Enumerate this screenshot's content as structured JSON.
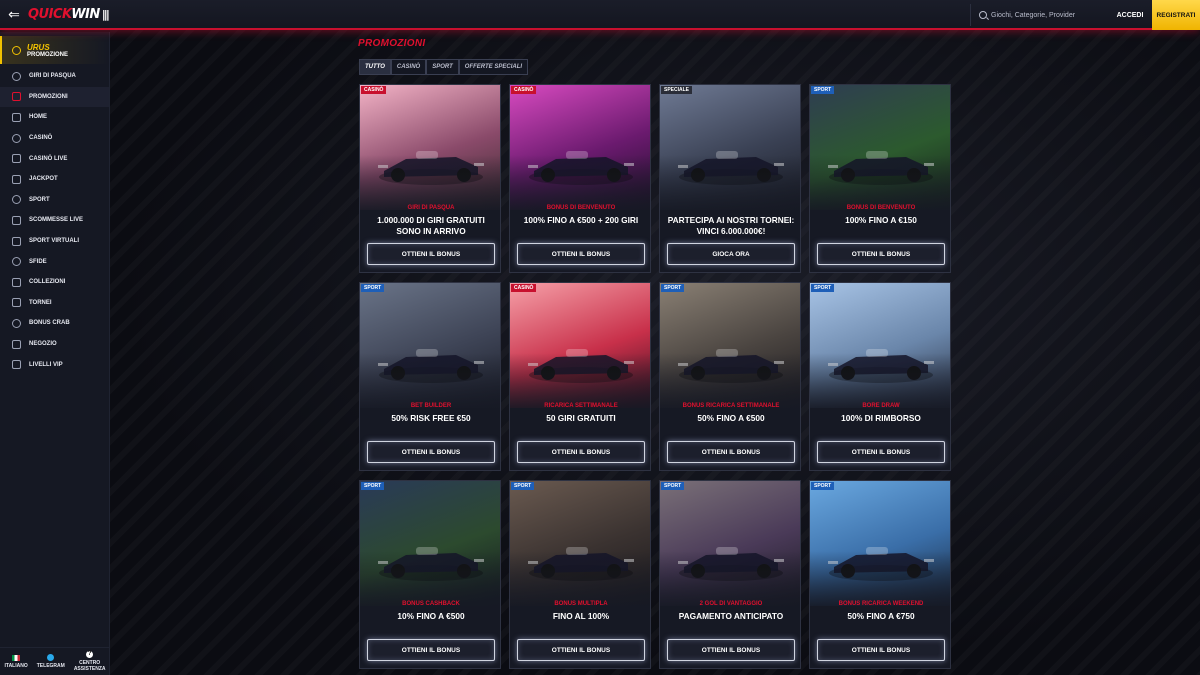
{
  "header": {
    "logo_quick": "QUICK",
    "logo_win": "WIN",
    "search_placeholder": "Giochi, Categorie, Provider",
    "login_label": "ACCEDI",
    "register_label": "REGISTRATI"
  },
  "sidebar": {
    "promo_title": "URUS",
    "promo_subtitle": "PROMOZIONE",
    "items": [
      {
        "label": "Giri di Pasqua",
        "icon": "egg-icon"
      },
      {
        "label": "Promozioni",
        "icon": "gift-icon"
      },
      {
        "label": "Home",
        "icon": "home-icon"
      },
      {
        "label": "Casinò",
        "icon": "casino-icon"
      },
      {
        "label": "Casinò Live",
        "icon": "live-casino-icon"
      },
      {
        "label": "Jackpot",
        "icon": "jackpot-icon"
      },
      {
        "label": "Sport",
        "icon": "ball-icon"
      },
      {
        "label": "Scommesse Live",
        "icon": "video-icon"
      },
      {
        "label": "Sport Virtuali",
        "icon": "virtual-icon"
      },
      {
        "label": "Sfide",
        "icon": "challenge-icon"
      },
      {
        "label": "Collezioni",
        "icon": "collection-icon"
      },
      {
        "label": "Tornei",
        "icon": "trophy-icon"
      },
      {
        "label": "Bonus Crab",
        "icon": "crab-icon"
      },
      {
        "label": "Negozio",
        "icon": "shop-icon"
      },
      {
        "label": "Livelli VIP",
        "icon": "diamond-icon"
      }
    ],
    "footer": {
      "language": "ITALIANO",
      "telegram": "TELEGRAM",
      "support_1": "CENTRO",
      "support_2": "ASSISTENZA"
    }
  },
  "main": {
    "title": "PROMOZIONI",
    "tabs": [
      "TUTTO",
      "CASINÒ",
      "SPORT",
      "OFFERTE SPECIALI"
    ],
    "active_tab": "TUTTO",
    "cards": [
      {
        "badge": "CASINÒ",
        "badge_type": "casino",
        "subtitle": "GIRI DI PASQUA",
        "title": "1.000.000 DI GIRI GRATUITI SONO IN ARRIVO",
        "button": "OTTIENI IL BONUS",
        "bg": [
          "#f3b3c6",
          "#8a4a6a",
          "#3b2a2e"
        ]
      },
      {
        "badge": "CASINÒ",
        "badge_type": "casino",
        "subtitle": "BONUS DI BENVENUTO",
        "title": "100% FINO A €500 + 200 GIRI",
        "button": "OTTIENI IL BONUS",
        "bg": [
          "#d84ac0",
          "#6a1a6e",
          "#1e1028"
        ]
      },
      {
        "badge": "SPECIALE",
        "badge_type": "speciale",
        "subtitle": "",
        "title": "PARTECIPA AI NOSTRI TORNEI: VINCI 6.000.000€!",
        "button": "GIOCA ORA",
        "bg": [
          "#6f7a94",
          "#3a4154",
          "#1a1d26"
        ]
      },
      {
        "badge": "SPORT",
        "badge_type": "sport",
        "subtitle": "BONUS DI BENVENUTO",
        "title": "100% FINO A €150",
        "button": "OTTIENI IL BONUS",
        "bg": [
          "#2f3d52",
          "#2c5a2e",
          "#18241c"
        ]
      },
      {
        "badge": "SPORT",
        "badge_type": "sport",
        "subtitle": "BET BUILDER",
        "title": "50% RISK FREE €50",
        "button": "OTTIENI IL BONUS",
        "bg": [
          "#6a7488",
          "#3e4456",
          "#1c1f2a"
        ]
      },
      {
        "badge": "CASINÒ",
        "badge_type": "casino",
        "subtitle": "RICARICA SETTIMANALE",
        "title": "50 GIRI GRATUITI",
        "button": "OTTIENI IL BONUS",
        "bg": [
          "#f6a0a8",
          "#c8304a",
          "#3a1020"
        ]
      },
      {
        "badge": "SPORT",
        "badge_type": "sport",
        "subtitle": "BONUS RICARICA SETTIMANALE",
        "title": "50% FINO A €500",
        "button": "OTTIENI IL BONUS",
        "bg": [
          "#8a8074",
          "#4a4440",
          "#1c1a1e"
        ]
      },
      {
        "badge": "SPORT",
        "badge_type": "sport",
        "subtitle": "BORE DRAW",
        "title": "100% DI RIMBORSO",
        "button": "OTTIENI IL BONUS",
        "bg": [
          "#a8c4e6",
          "#6a86aa",
          "#2a3244"
        ]
      },
      {
        "badge": "SPORT",
        "badge_type": "sport",
        "subtitle": "BONUS CASHBACK",
        "title": "10% FINO A €500",
        "button": "OTTIENI IL BONUS",
        "bg": [
          "#2a3a58",
          "#2c4a2e",
          "#141a20"
        ]
      },
      {
        "badge": "SPORT",
        "badge_type": "sport",
        "subtitle": "BONUS MULTIPLA",
        "title": "FINO AL 100%",
        "button": "OTTIENI IL BONUS",
        "bg": [
          "#6a5a50",
          "#3a3230",
          "#1a181c"
        ]
      },
      {
        "badge": "SPORT",
        "badge_type": "sport",
        "subtitle": "2 GOL DI VANTAGGIO",
        "title": "PAGAMENTO ANTICIPATO",
        "button": "OTTIENI IL BONUS",
        "bg": [
          "#7a7078",
          "#4a3a58",
          "#1c1a24"
        ]
      },
      {
        "badge": "SPORT",
        "badge_type": "sport",
        "subtitle": "BONUS RICARICA WEEKEND",
        "title": "50% FINO A €750",
        "button": "OTTIENI IL BONUS",
        "bg": [
          "#6aa8e0",
          "#3a6ea8",
          "#1a2a40"
        ]
      }
    ]
  }
}
